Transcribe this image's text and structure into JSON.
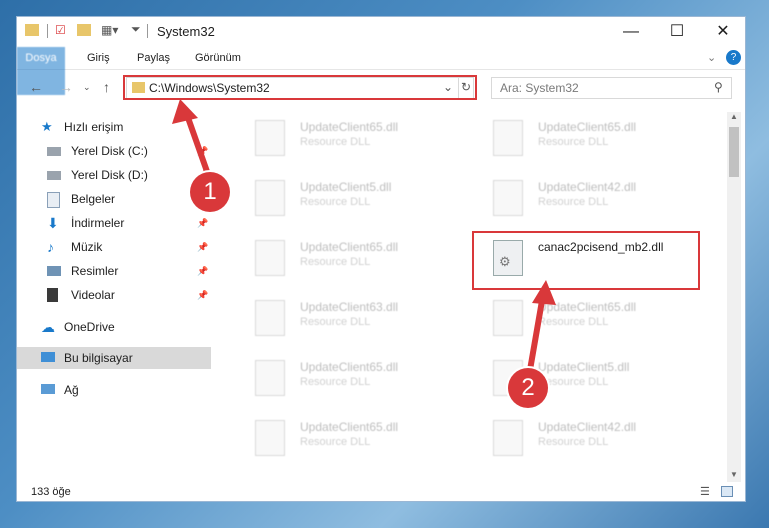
{
  "window": {
    "title": "System32",
    "controls": {
      "minimize": "—",
      "maximize": "☐",
      "close": "✕"
    }
  },
  "ribbon": {
    "tabs": [
      "Dosya",
      "Giriş",
      "Paylaş",
      "Görünüm"
    ],
    "expand": "⌄",
    "help": "?"
  },
  "address": {
    "path": "C:\\Windows\\System32"
  },
  "search": {
    "placeholder": "Ara: System32"
  },
  "sidebar": {
    "items": [
      {
        "label": "Hızlı erişim",
        "icon": "star-icon"
      },
      {
        "label": "Yerel Disk (C:)",
        "icon": "drive-icon"
      },
      {
        "label": "Yerel Disk (D:)",
        "icon": "drive-icon"
      },
      {
        "label": "Belgeler",
        "icon": "documents-icon"
      },
      {
        "label": "İndirmeler",
        "icon": "download-icon"
      },
      {
        "label": "Müzik",
        "icon": "music-icon"
      },
      {
        "label": "Resimler",
        "icon": "pictures-icon"
      },
      {
        "label": "Videolar",
        "icon": "videos-icon"
      },
      {
        "label": "OneDrive",
        "icon": "cloud-icon"
      },
      {
        "label": "Bu bilgisayar",
        "icon": "computer-icon"
      },
      {
        "label": "Ağ",
        "icon": "network-icon"
      }
    ]
  },
  "files": [
    {
      "name": "UpdateClient65.dll",
      "type": "Resource DLL"
    },
    {
      "name": "UpdateClient65.dll",
      "type": "Resource DLL"
    },
    {
      "name": "UpdateClient5.dll",
      "type": "Resource DLL"
    },
    {
      "name": "UpdateClient42.dll",
      "type": "Resource DLL"
    },
    {
      "name": "UpdateClient65.dll",
      "type": "Resource DLL"
    },
    {
      "name": "canac2pcisend_mb2.dll",
      "type": ""
    },
    {
      "name": "UpdateClient63.dll",
      "type": "Resource DLL"
    },
    {
      "name": "UpdateClient65.dll",
      "type": "Resource DLL"
    },
    {
      "name": "UpdateClient65.dll",
      "type": "Resource DLL"
    },
    {
      "name": "UpdateClient5.dll",
      "type": "Resource DLL"
    },
    {
      "name": "UpdateClient65.dll",
      "type": "Resource DLL"
    },
    {
      "name": "UpdateClient42.dll",
      "type": "Resource DLL"
    }
  ],
  "status": {
    "count": "133 öğe"
  },
  "annotations": {
    "badge1": "1",
    "badge2": "2"
  },
  "colors": {
    "accent": "#1979ca",
    "highlight": "#d9383a"
  }
}
